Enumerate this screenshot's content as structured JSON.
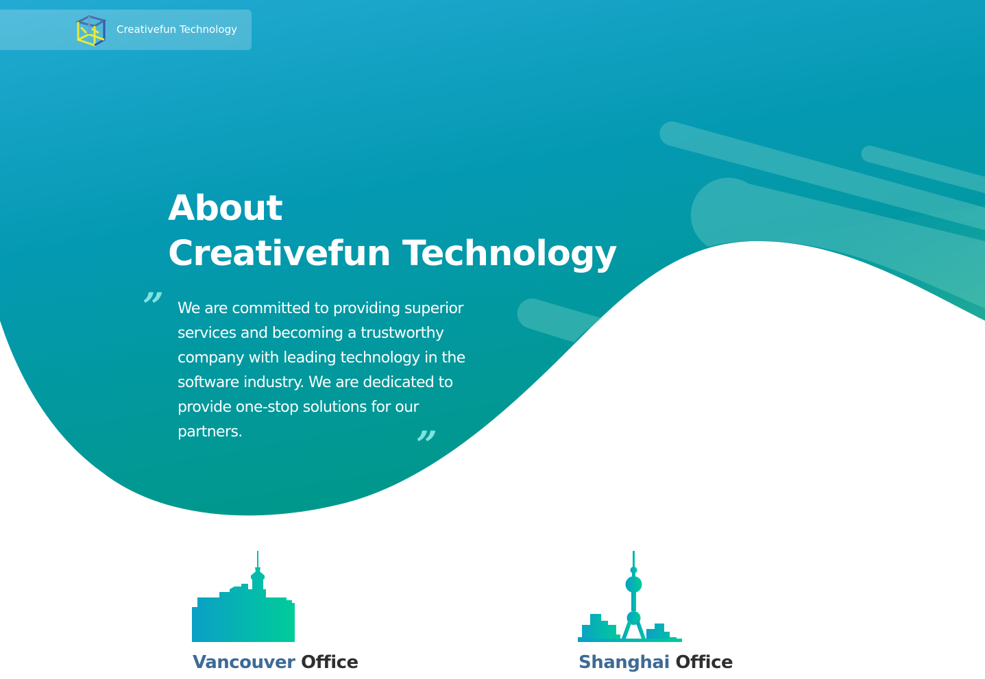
{
  "header": {
    "brand_name": "Creativefun Technology",
    "logo_icon": "cube-logo-icon"
  },
  "hero": {
    "title_line1": "About",
    "title_line2": "Creativefun Technology",
    "quote_open": "”",
    "quote_close": "”",
    "mission": "We are committed to providing superior services and becoming a trustworthy company with leading technology in the software industry. We are dedicated to provide one-stop solutions for our partners."
  },
  "offices": [
    {
      "city": "Vancouver",
      "suffix": " Office",
      "icon": "vancouver-skyline-icon"
    },
    {
      "city": "Shanghai",
      "suffix": " Office",
      "icon": "shanghai-skyline-icon"
    }
  ],
  "colors": {
    "gradient_top": "#1fa9cf",
    "gradient_bottom": "#009987",
    "accent_quote": "#7fe3e0",
    "city_text": "#3e6b96",
    "office_text": "#2f2f2f",
    "skyline_start": "#0a9fc7",
    "skyline_end": "#00cc99"
  }
}
